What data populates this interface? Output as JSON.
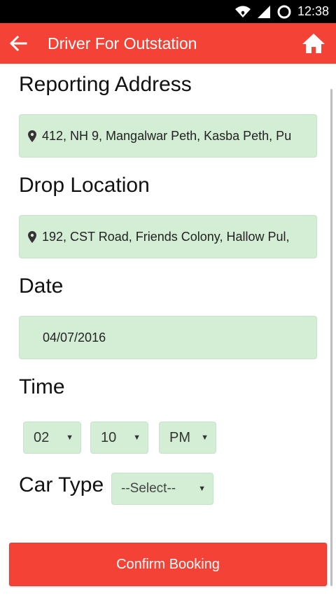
{
  "status_bar": {
    "time": "12:38"
  },
  "app_bar": {
    "title": "Driver For Outstation"
  },
  "form": {
    "reporting_address": {
      "label": "Reporting Address",
      "value": "412, NH 9, Mangalwar Peth, Kasba Peth, Pu"
    },
    "drop_location": {
      "label": "Drop Location",
      "value": "192, CST Road, Friends Colony, Hallow Pul,"
    },
    "date": {
      "label": "Date",
      "value": "04/07/2016"
    },
    "time": {
      "label": "Time",
      "hour": "02",
      "minute": "10",
      "meridiem": "PM"
    },
    "car_type": {
      "label": "Car Type",
      "value": "--Select--"
    }
  },
  "confirm_button": {
    "label": "Confirm Booking"
  },
  "colors": {
    "primary": "#f44336",
    "field_bg": "#d4eed6",
    "status_bar": "#000000"
  },
  "icons": [
    "wifi-icon",
    "signal-icon",
    "sync-icon",
    "back-arrow-icon",
    "home-icon",
    "location-pin-icon",
    "dropdown-arrow-icon"
  ]
}
